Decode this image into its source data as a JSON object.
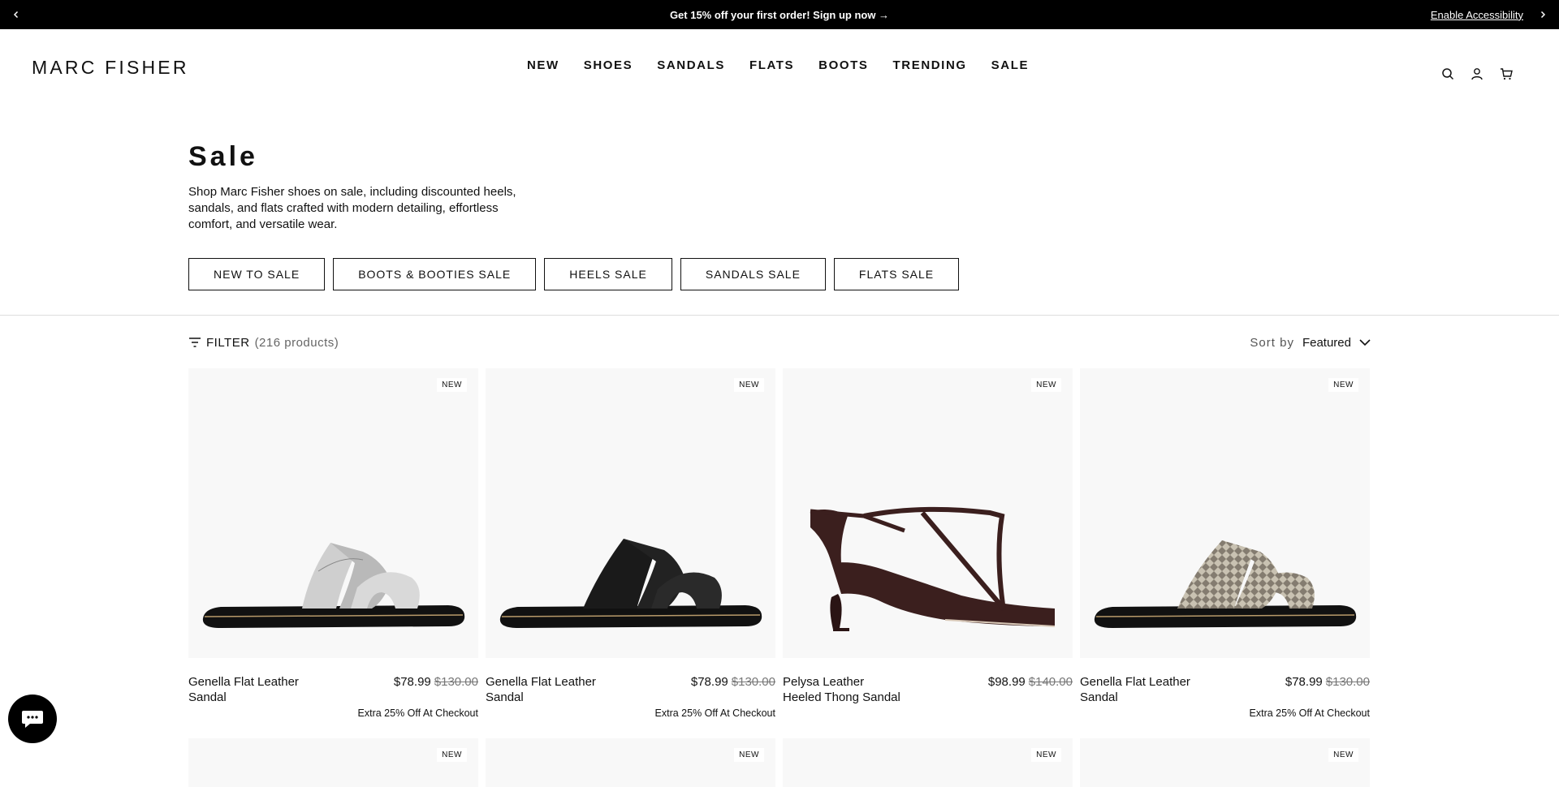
{
  "announcement": {
    "text": "Get 15% off your first order! Sign up now →",
    "accessibility": "Enable Accessibility"
  },
  "brand": {
    "logo": "MARC FISHER"
  },
  "nav": [
    "NEW",
    "SHOES",
    "SANDALS",
    "FLATS",
    "BOOTS",
    "TRENDING",
    "SALE"
  ],
  "page": {
    "title": "Sale",
    "description": "Shop Marc Fisher shoes on sale, including discounted heels, sandals, and flats crafted with modern detailing, effortless comfort, and versatile wear."
  },
  "categories": [
    "NEW TO SALE",
    "BOOTS & BOOTIES SALE",
    "HEELS SALE",
    "SANDALS SALE",
    "FLATS SALE"
  ],
  "toolbar": {
    "filter_label": "FILTER",
    "count": "(216 products)",
    "sort_label": "Sort by",
    "sort_value": "Featured"
  },
  "products": [
    {
      "badge": "NEW",
      "name": "Genella Flat Leather Sandal",
      "price": "$78.99",
      "original": "$130.00",
      "promo": "Extra 25% Off At Checkout",
      "color": "#c8c8c8"
    },
    {
      "badge": "NEW",
      "name": "Genella Flat Leather Sandal",
      "price": "$78.99",
      "original": "$130.00",
      "promo": "Extra 25% Off At Checkout",
      "color": "#1a1a1a"
    },
    {
      "badge": "NEW",
      "name": "Pelysa Leather Heeled Thong Sandal",
      "price": "$98.99",
      "original": "$140.00",
      "promo": "",
      "color": "#3b1f1e"
    },
    {
      "badge": "NEW",
      "name": "Genella Flat Leather Sandal",
      "price": "$78.99",
      "original": "$130.00",
      "promo": "Extra 25% Off At Checkout",
      "color": "#bdb6a8"
    }
  ],
  "row2_badges": [
    "NEW",
    "NEW",
    "NEW",
    "NEW"
  ],
  "icons": {
    "search": "search-icon",
    "account": "user-icon",
    "cart": "cart-icon",
    "chat": "chat-icon",
    "prev": "chevron-left-icon",
    "next": "chevron-right-icon",
    "filter": "filter-icon",
    "sort": "chevron-down-icon"
  }
}
